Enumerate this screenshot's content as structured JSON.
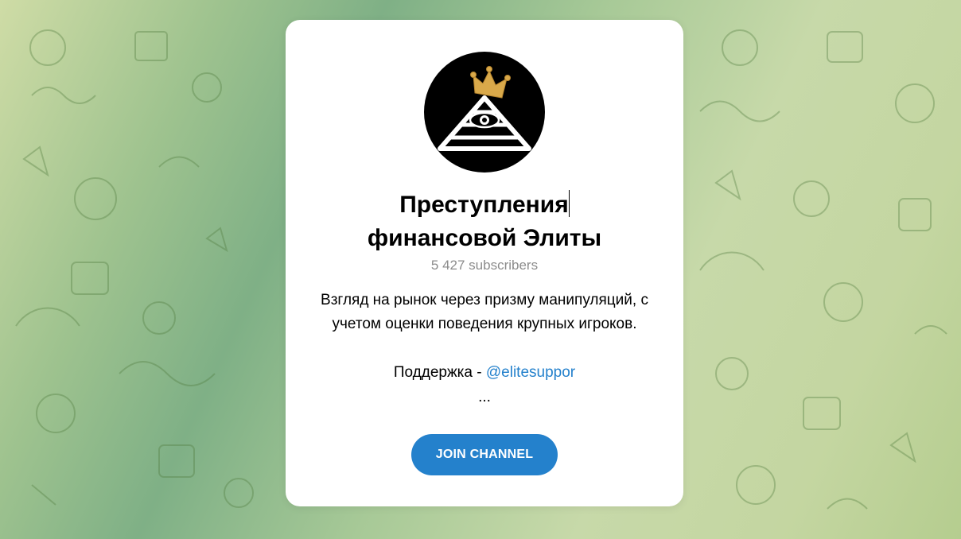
{
  "channel": {
    "title_line1": "Преступления",
    "title_line2": "финансовой Элиты",
    "subscribers": "5 427 subscribers",
    "description_line1": "Взгляд на рынок через призму манипуляций, с",
    "description_line2": "учетом оценки поведения крупных игроков.",
    "support_label": "Поддержка - ",
    "support_link": "@elitesuppor",
    "ellipsis": "..."
  },
  "actions": {
    "join_label": "JOIN CHANNEL"
  },
  "avatar": {
    "icon": "pyramid-eye-crown-icon"
  },
  "colors": {
    "accent": "#2481cc",
    "card_bg": "#ffffff",
    "muted_text": "#8c8c8c",
    "avatar_bg": "#000000",
    "crown": "#d9a94a",
    "background_green": "#9fc38f"
  }
}
